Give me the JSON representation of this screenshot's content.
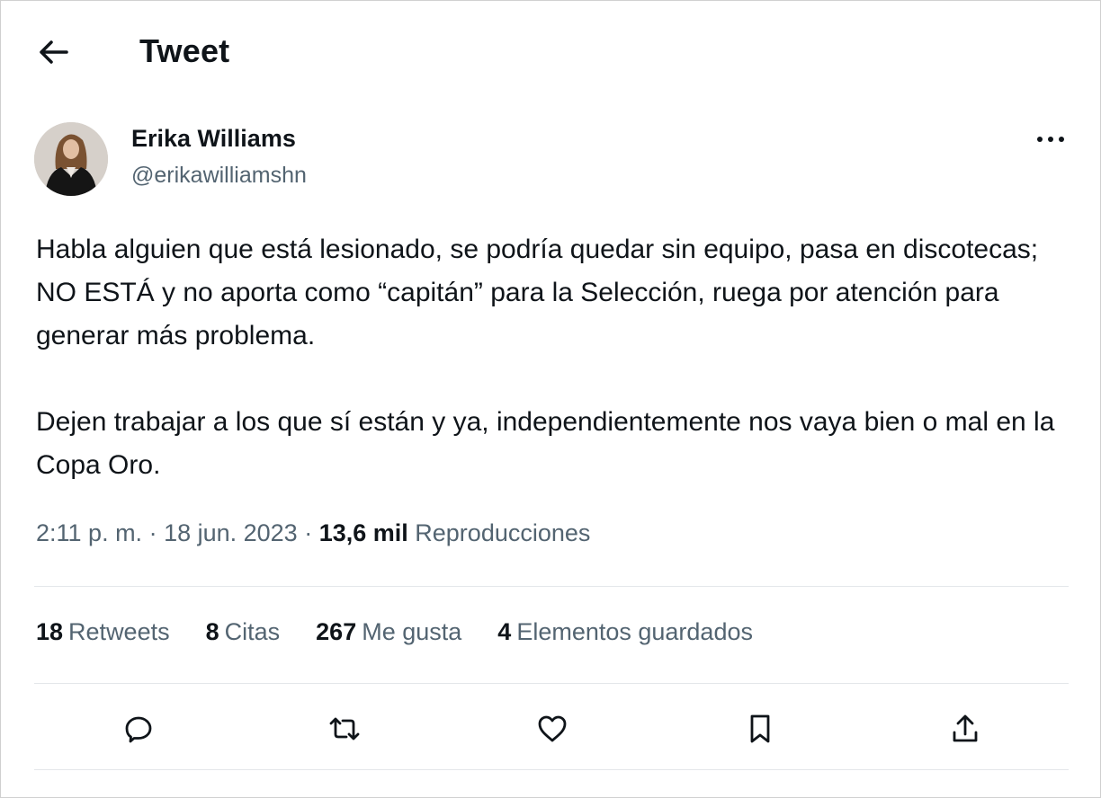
{
  "header": {
    "title": "Tweet",
    "back_icon": "arrow-left-icon"
  },
  "author": {
    "name": "Erika Williams",
    "handle": "@erikawilliamshn",
    "more_icon": "more-horizontal-icon"
  },
  "tweet": {
    "paragraphs": [
      "Habla alguien que está lesionado, se podría quedar sin equipo, pasa en discotecas; NO ESTÁ y no aporta como “capitán” para la Selección, ruega por atención para generar más problema.",
      "Dejen trabajar a los que sí están y ya, independientemente nos vaya bien o mal en la Copa Oro."
    ],
    "time": "2:11 p. m.",
    "separator": " · ",
    "date": "18 jun. 2023",
    "views_count": "13,6 mil",
    "views_label": "Reproducciones"
  },
  "stats": [
    {
      "count": "18",
      "label": "Retweets"
    },
    {
      "count": "8",
      "label": "Citas"
    },
    {
      "count": "267",
      "label": "Me gusta"
    },
    {
      "count": "4",
      "label": "Elementos guardados"
    }
  ],
  "actions": [
    {
      "name": "reply",
      "icon": "reply-icon"
    },
    {
      "name": "retweet",
      "icon": "retweet-icon"
    },
    {
      "name": "like",
      "icon": "heart-icon"
    },
    {
      "name": "bookmark",
      "icon": "bookmark-icon"
    },
    {
      "name": "share",
      "icon": "share-icon"
    }
  ],
  "colors": {
    "text": "#0f1419",
    "secondary": "#536471",
    "divider": "#e4e7ea"
  }
}
